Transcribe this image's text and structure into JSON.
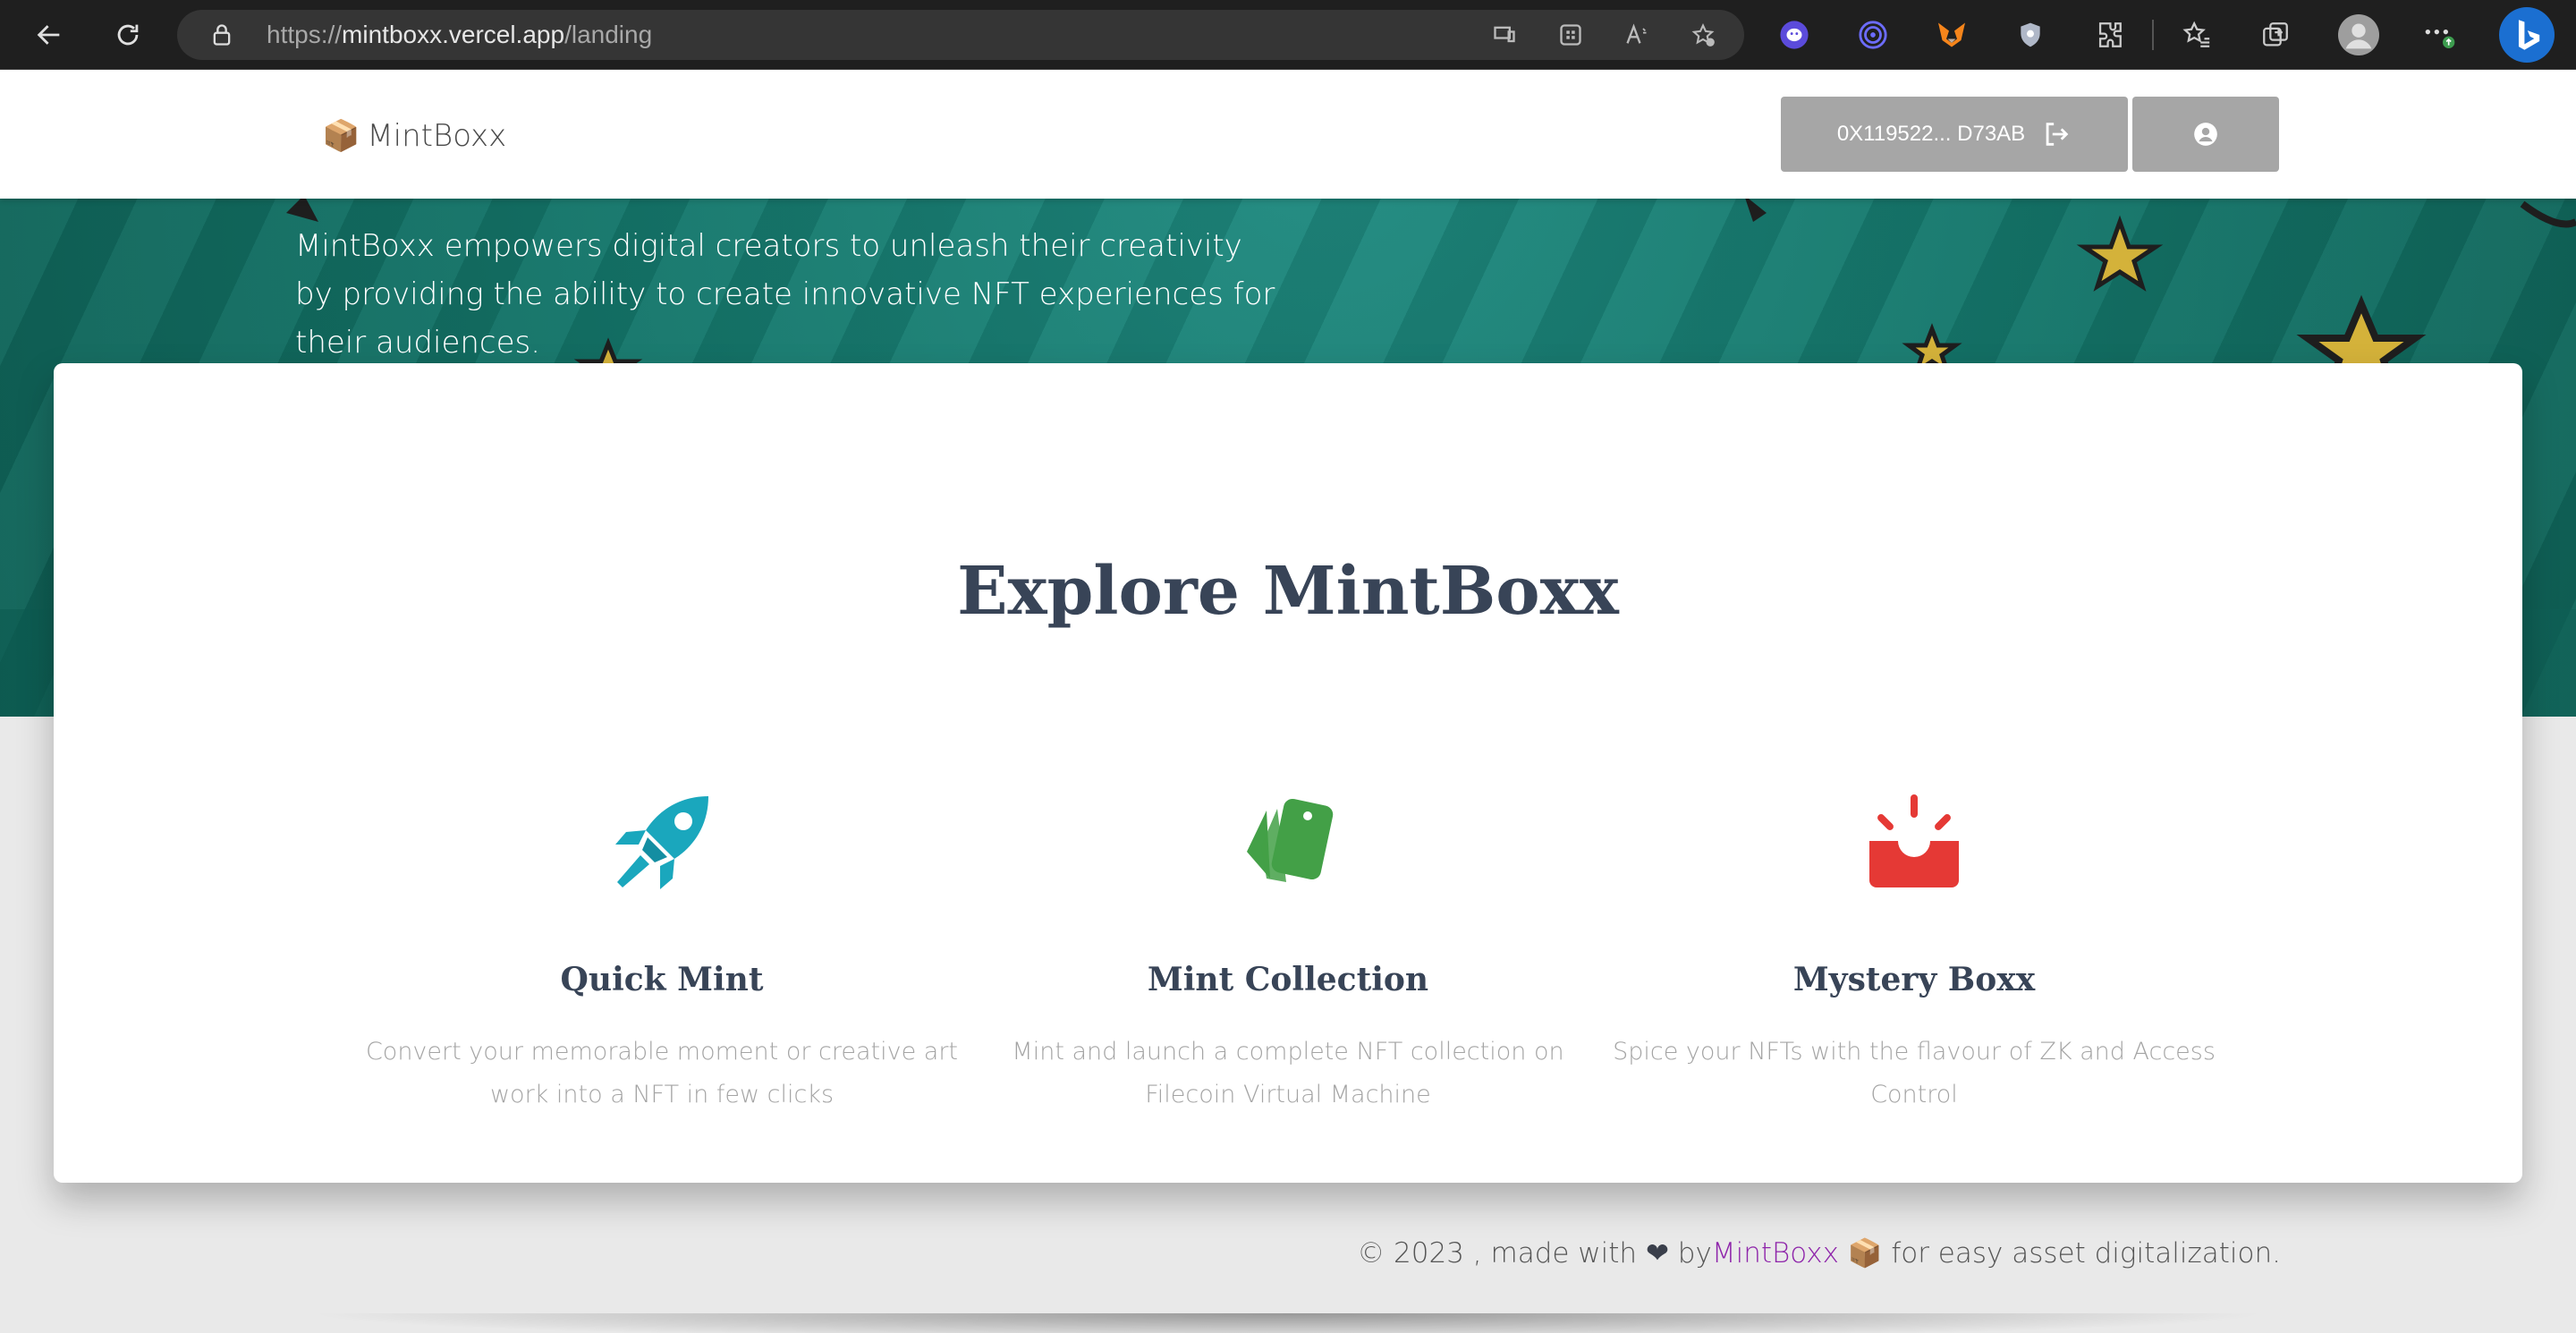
{
  "browser": {
    "url_scheme": "https://",
    "url_host": "mintboxx.vercel.app",
    "url_path": "/landing"
  },
  "header": {
    "brand_emoji": "📦",
    "brand_name": "MintBoxx",
    "wallet_label": "0X119522... D73AB"
  },
  "hero": {
    "tagline": "MintBoxx empowers digital creators to unleash their creativity by providing the ability to create innovative NFT experiences for their audiences."
  },
  "explore": {
    "title": "Explore MintBoxx",
    "features": [
      {
        "title": "Quick Mint",
        "description": "Convert your memorable moment or creative art work into a NFT in few clicks",
        "icon": "rocket-icon",
        "color": "#1aa7bd"
      },
      {
        "title": "Mint Collection",
        "description": "Mint and launch a complete NFT collection on Filecoin Virtual Machine",
        "icon": "tags-icon",
        "color": "#43a047"
      },
      {
        "title": "Mystery Boxx",
        "description": "Spice your NFTs with the flavour of ZK and Access Control",
        "icon": "mystery-box-icon",
        "color": "#e53935"
      }
    ]
  },
  "footer": {
    "prefix": "© 2023 , made with",
    "heart": "❤",
    "by": "by",
    "brand": "MintBoxx",
    "emoji": "📦",
    "suffix": "for easy asset digitalization.",
    "link_color": "#8e24aa"
  }
}
